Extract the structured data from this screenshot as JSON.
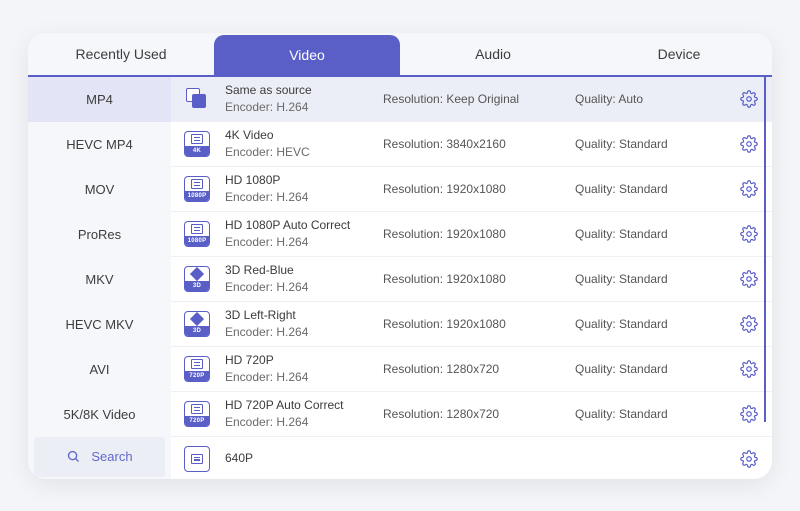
{
  "tabs": [
    {
      "label": "Recently Used",
      "active": false
    },
    {
      "label": "Video",
      "active": true
    },
    {
      "label": "Audio",
      "active": false
    },
    {
      "label": "Device",
      "active": false
    }
  ],
  "sidebar": {
    "items": [
      {
        "label": "MP4",
        "active": true
      },
      {
        "label": "HEVC MP4",
        "active": false
      },
      {
        "label": "MOV",
        "active": false
      },
      {
        "label": "ProRes",
        "active": false
      },
      {
        "label": "MKV",
        "active": false
      },
      {
        "label": "HEVC MKV",
        "active": false
      },
      {
        "label": "AVI",
        "active": false
      },
      {
        "label": "5K/8K Video",
        "active": false
      }
    ],
    "search_label": "Search"
  },
  "resolution_prefix": "Resolution: ",
  "quality_prefix": "Quality: ",
  "encoder_prefix": "Encoder: ",
  "presets": [
    {
      "title": "Same as source",
      "encoder": "H.264",
      "resolution": "Keep Original",
      "quality": "Auto",
      "icon": "copy",
      "badge": "",
      "selected": true
    },
    {
      "title": "4K Video",
      "encoder": "HEVC",
      "resolution": "3840x2160",
      "quality": "Standard",
      "icon": "film",
      "badge": "4K",
      "selected": false
    },
    {
      "title": "HD 1080P",
      "encoder": "H.264",
      "resolution": "1920x1080",
      "quality": "Standard",
      "icon": "film",
      "badge": "1080P",
      "selected": false
    },
    {
      "title": "HD 1080P Auto Correct",
      "encoder": "H.264",
      "resolution": "1920x1080",
      "quality": "Standard",
      "icon": "film",
      "badge": "1080P",
      "selected": false
    },
    {
      "title": "3D Red-Blue",
      "encoder": "H.264",
      "resolution": "1920x1080",
      "quality": "Standard",
      "icon": "cube",
      "badge": "3D",
      "selected": false
    },
    {
      "title": "3D Left-Right",
      "encoder": "H.264",
      "resolution": "1920x1080",
      "quality": "Standard",
      "icon": "cube",
      "badge": "3D",
      "selected": false
    },
    {
      "title": "HD 720P",
      "encoder": "H.264",
      "resolution": "1280x720",
      "quality": "Standard",
      "icon": "film",
      "badge": "720P",
      "selected": false
    },
    {
      "title": "HD 720P Auto Correct",
      "encoder": "H.264",
      "resolution": "1280x720",
      "quality": "Standard",
      "icon": "film",
      "badge": "720P",
      "selected": false
    },
    {
      "title": "640P",
      "encoder": "",
      "resolution": "",
      "quality": "",
      "icon": "film",
      "badge": "",
      "selected": false
    }
  ]
}
